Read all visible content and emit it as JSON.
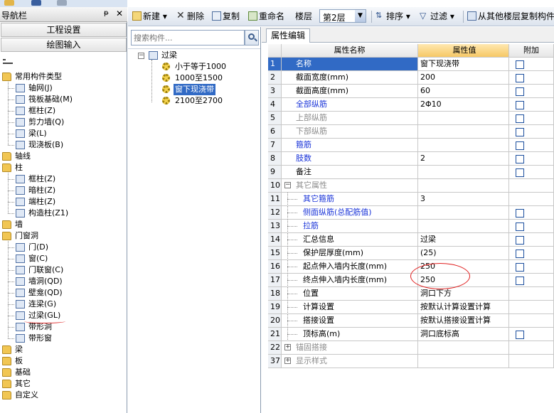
{
  "nav": {
    "title": "导航栏",
    "pin_glyph": "ᵽ",
    "close_glyph": "✕",
    "buttons": [
      "工程设置",
      "绘图输入"
    ],
    "tree": [
      {
        "label": "常用构件类型",
        "level": 0,
        "kind": "folder"
      },
      {
        "label": "轴网(J)",
        "level": 1,
        "kind": "item"
      },
      {
        "label": "筏板基础(M)",
        "level": 1,
        "kind": "item"
      },
      {
        "label": "框柱(Z)",
        "level": 1,
        "kind": "item"
      },
      {
        "label": "剪力墙(Q)",
        "level": 1,
        "kind": "item"
      },
      {
        "label": "梁(L)",
        "level": 1,
        "kind": "item"
      },
      {
        "label": "现浇板(B)",
        "level": 1,
        "kind": "item"
      },
      {
        "label": "轴线",
        "level": 0,
        "kind": "folder"
      },
      {
        "label": "柱",
        "level": 0,
        "kind": "folder"
      },
      {
        "label": "框柱(Z)",
        "level": 1,
        "kind": "item"
      },
      {
        "label": "暗柱(Z)",
        "level": 1,
        "kind": "item"
      },
      {
        "label": "端柱(Z)",
        "level": 1,
        "kind": "item"
      },
      {
        "label": "构造柱(Z1)",
        "level": 1,
        "kind": "item"
      },
      {
        "label": "墙",
        "level": 0,
        "kind": "folder"
      },
      {
        "label": "门窗洞",
        "level": 0,
        "kind": "folder"
      },
      {
        "label": "门(D)",
        "level": 1,
        "kind": "item"
      },
      {
        "label": "窗(C)",
        "level": 1,
        "kind": "item"
      },
      {
        "label": "门联窗(C)",
        "level": 1,
        "kind": "item"
      },
      {
        "label": "墙洞(QD)",
        "level": 1,
        "kind": "item"
      },
      {
        "label": "壁龛(QD)",
        "level": 1,
        "kind": "item"
      },
      {
        "label": "连梁(G)",
        "level": 1,
        "kind": "item"
      },
      {
        "label": "过梁(GL)",
        "level": 1,
        "kind": "item"
      },
      {
        "label": "带形洞",
        "level": 1,
        "kind": "item"
      },
      {
        "label": "带形窗",
        "level": 1,
        "kind": "item"
      },
      {
        "label": "梁",
        "level": 0,
        "kind": "folder"
      },
      {
        "label": "板",
        "level": 0,
        "kind": "folder"
      },
      {
        "label": "基础",
        "level": 0,
        "kind": "folder"
      },
      {
        "label": "其它",
        "level": 0,
        "kind": "folder"
      },
      {
        "label": "自定义",
        "level": 0,
        "kind": "folder"
      }
    ]
  },
  "toolbar": {
    "new_label": "新建",
    "delete_label": "删除",
    "copy_label": "复制",
    "rename_label": "重命名",
    "floor_label": "楼层",
    "floor_value": "第2层",
    "sort_label": "排序",
    "filter_label": "过滤",
    "copy_from_floor_label": "从其他楼层复制构件",
    "dropdown_glyph": "▾"
  },
  "components": {
    "search_placeholder": "搜索构件...",
    "root": "过梁",
    "collapse_glyph": "−",
    "items": [
      "小于等于1000",
      "1000至1500",
      "窗下现浇带",
      "2100至2700"
    ],
    "selected_index": 2
  },
  "properties": {
    "tab": "属性编辑",
    "headers": {
      "name": "属性名称",
      "value": "属性值",
      "add": "附加"
    },
    "rows": [
      {
        "num": "1",
        "name": "名称",
        "value": "窗下现浇带",
        "check": false,
        "style": "blue",
        "selected": true
      },
      {
        "num": "2",
        "name": "截面宽度(mm)",
        "value": "200",
        "check": true,
        "style": "normal"
      },
      {
        "num": "3",
        "name": "截面高度(mm)",
        "value": "60",
        "check": true,
        "style": "normal"
      },
      {
        "num": "4",
        "name": "全部纵筋",
        "value": "2Φ10",
        "check": true,
        "style": "blue"
      },
      {
        "num": "5",
        "name": "上部纵筋",
        "value": "",
        "check": true,
        "style": "gray"
      },
      {
        "num": "6",
        "name": "下部纵筋",
        "value": "",
        "check": true,
        "style": "gray"
      },
      {
        "num": "7",
        "name": "箍筋",
        "value": "",
        "check": true,
        "style": "blue"
      },
      {
        "num": "8",
        "name": "肢数",
        "value": "2",
        "check": true,
        "style": "blue"
      },
      {
        "num": "9",
        "name": "备注",
        "value": "",
        "check": true,
        "style": "normal"
      },
      {
        "num": "10",
        "name": "其它属性",
        "value": "",
        "check": null,
        "style": "group",
        "expander": "−"
      },
      {
        "num": "11",
        "name": "其它箍筋",
        "value": "3",
        "check": null,
        "style": "blue-child"
      },
      {
        "num": "12",
        "name": "侧面纵筋(总配筋值)",
        "value": "",
        "check": true,
        "style": "blue-child"
      },
      {
        "num": "13",
        "name": "拉筋",
        "value": "",
        "check": true,
        "style": "blue-child"
      },
      {
        "num": "14",
        "name": "汇总信息",
        "value": "过梁",
        "check": true,
        "style": "child"
      },
      {
        "num": "15",
        "name": "保护层厚度(mm)",
        "value": "(25)",
        "check": true,
        "style": "child"
      },
      {
        "num": "16",
        "name": "起点伸入墙内长度(mm)",
        "value": "250",
        "check": true,
        "style": "child"
      },
      {
        "num": "17",
        "name": "终点伸入墙内长度(mm)",
        "value": "250",
        "check": true,
        "style": "child"
      },
      {
        "num": "18",
        "name": "位置",
        "value": "洞口下方",
        "check": null,
        "style": "child"
      },
      {
        "num": "19",
        "name": "计算设置",
        "value": "按默认计算设置计算",
        "check": null,
        "style": "child"
      },
      {
        "num": "20",
        "name": "搭接设置",
        "value": "按默认搭接设置计算",
        "check": null,
        "style": "child"
      },
      {
        "num": "21",
        "name": "顶标高(m)",
        "value": "洞口底标高",
        "check": true,
        "style": "child"
      },
      {
        "num": "22",
        "name": "锚固搭接",
        "value": "",
        "check": null,
        "style": "group",
        "expander": "+"
      },
      {
        "num": "37",
        "name": "显示样式",
        "value": "",
        "check": null,
        "style": "group",
        "expander": "+"
      }
    ]
  },
  "colors": {
    "selection": "#316ac5",
    "link_blue": "#1a34d8",
    "value_header": "#f6c866",
    "annotation_red": "#e02020"
  }
}
